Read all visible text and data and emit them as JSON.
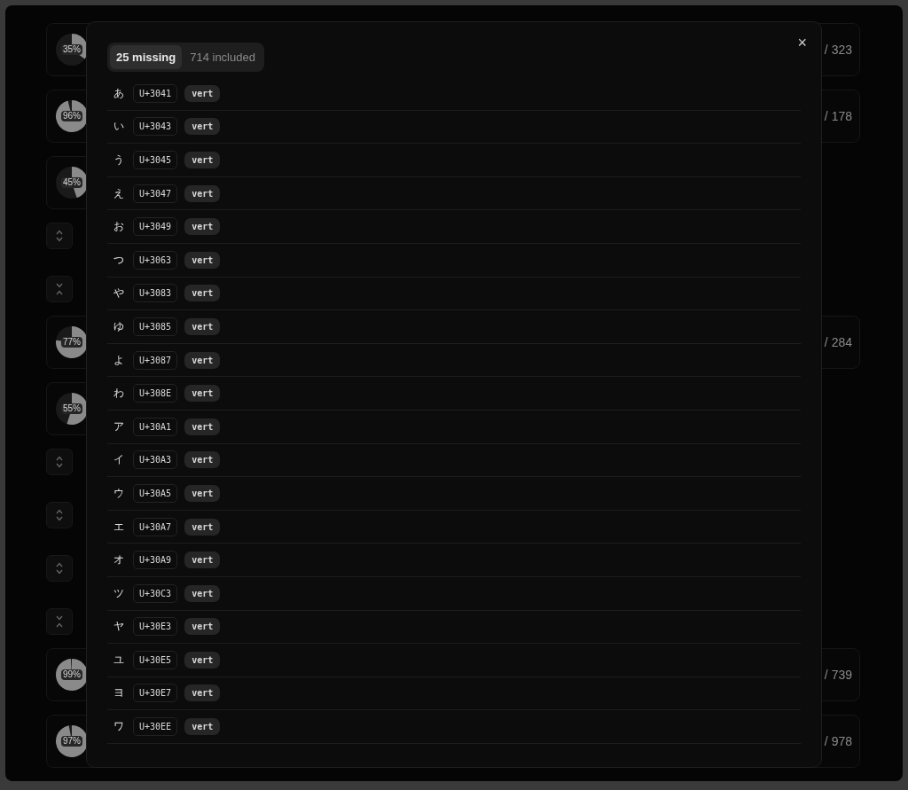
{
  "background_list": [
    {
      "kind": "card",
      "percent": "35%",
      "count": "/ 323"
    },
    {
      "kind": "card",
      "percent": "96%",
      "count": "/ 178"
    },
    {
      "kind": "card",
      "percent": "45%"
    },
    {
      "kind": "group",
      "expanded": false
    },
    {
      "kind": "group",
      "expanded": true
    },
    {
      "kind": "card",
      "percent": "77%",
      "count": "/ 284"
    },
    {
      "kind": "card",
      "percent": "55%"
    },
    {
      "kind": "group",
      "expanded": false
    },
    {
      "kind": "group",
      "expanded": false
    },
    {
      "kind": "group",
      "expanded": false
    },
    {
      "kind": "group",
      "expanded": true
    },
    {
      "kind": "card",
      "percent": "99%",
      "count": "/ 739"
    },
    {
      "kind": "card",
      "percent": "97%",
      "count": "/ 978"
    }
  ],
  "dialog": {
    "close": "×",
    "tabs": [
      {
        "label": "25 missing",
        "selected": true
      },
      {
        "label": "714 included",
        "selected": false
      }
    ],
    "rows": [
      {
        "char": "あ",
        "codepoint": "U+3041",
        "feature": "vert"
      },
      {
        "char": "い",
        "codepoint": "U+3043",
        "feature": "vert"
      },
      {
        "char": "う",
        "codepoint": "U+3045",
        "feature": "vert"
      },
      {
        "char": "え",
        "codepoint": "U+3047",
        "feature": "vert"
      },
      {
        "char": "お",
        "codepoint": "U+3049",
        "feature": "vert"
      },
      {
        "char": "つ",
        "codepoint": "U+3063",
        "feature": "vert"
      },
      {
        "char": "や",
        "codepoint": "U+3083",
        "feature": "vert"
      },
      {
        "char": "ゆ",
        "codepoint": "U+3085",
        "feature": "vert"
      },
      {
        "char": "よ",
        "codepoint": "U+3087",
        "feature": "vert"
      },
      {
        "char": "わ",
        "codepoint": "U+308E",
        "feature": "vert"
      },
      {
        "char": "ア",
        "codepoint": "U+30A1",
        "feature": "vert"
      },
      {
        "char": "イ",
        "codepoint": "U+30A3",
        "feature": "vert"
      },
      {
        "char": "ウ",
        "codepoint": "U+30A5",
        "feature": "vert"
      },
      {
        "char": "エ",
        "codepoint": "U+30A7",
        "feature": "vert"
      },
      {
        "char": "オ",
        "codepoint": "U+30A9",
        "feature": "vert"
      },
      {
        "char": "ツ",
        "codepoint": "U+30C3",
        "feature": "vert"
      },
      {
        "char": "ヤ",
        "codepoint": "U+30E3",
        "feature": "vert"
      },
      {
        "char": "ユ",
        "codepoint": "U+30E5",
        "feature": "vert"
      },
      {
        "char": "ヨ",
        "codepoint": "U+30E7",
        "feature": "vert"
      },
      {
        "char": "ワ",
        "codepoint": "U+30EE",
        "feature": "vert"
      }
    ]
  }
}
